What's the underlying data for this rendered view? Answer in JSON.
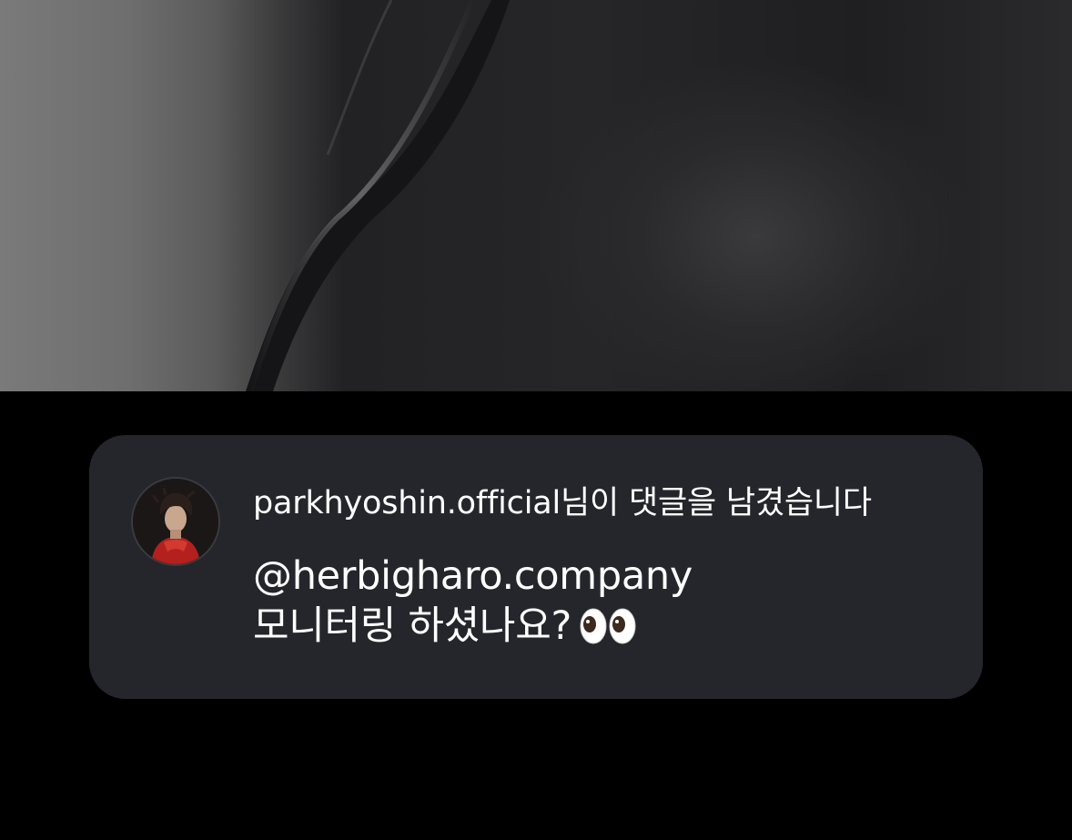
{
  "notification": {
    "username": "parkhyoshin.official",
    "action_text": "님이 댓글을 남겼습니다",
    "comment_mention": "@herbigharo.company",
    "comment_text": "모니터링 하셨나요?",
    "comment_emoji_icon": "eyes-emoji-icon"
  },
  "colors": {
    "card_background": "#25262b",
    "page_background": "#000000",
    "text": "#ffffff"
  }
}
